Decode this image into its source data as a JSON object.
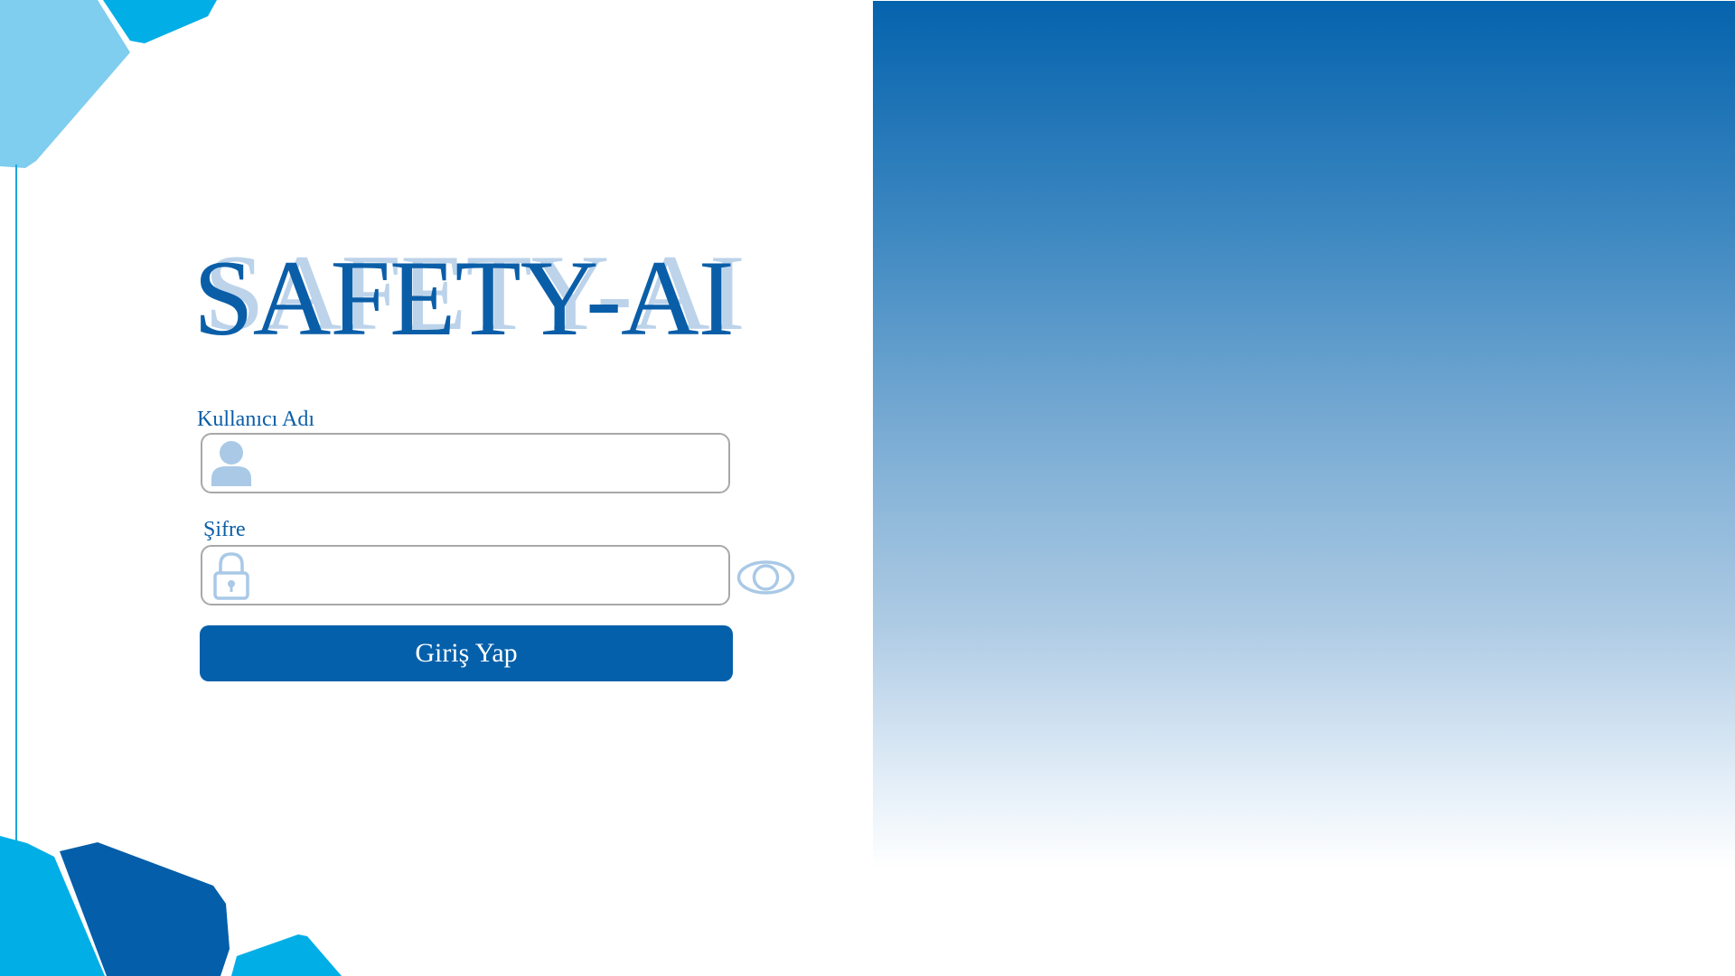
{
  "app": {
    "title": "SAFETY-AI"
  },
  "login_form": {
    "username_label": "Kullanıcı Adı",
    "username_value": "",
    "password_label": "Şifre",
    "password_value": "",
    "submit_label": "Giriş Yap"
  },
  "icons": {
    "username": "user-icon",
    "password": "lock-icon",
    "toggle_password": "eye-icon"
  },
  "colors": {
    "brand_primary": "#0a5ea8",
    "button": "#0560ab",
    "title_shadow": "#bcd3ea",
    "decor_light": "#7fcdef",
    "decor_cyan": "#02aee6",
    "decor_dark": "#045ea9",
    "input_icon": "#a9c9e6"
  }
}
